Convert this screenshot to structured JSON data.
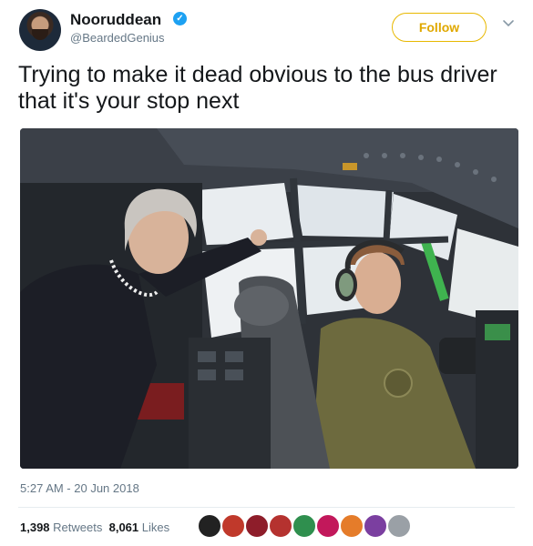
{
  "author": {
    "name": "Nooruddean",
    "handle": "@BeardedGenius",
    "verified_icon": "verified-badge-icon"
  },
  "follow_label": "Follow",
  "tweet_text": "Trying to make it dead obvious to the bus driver that it's your stop next",
  "timestamp": "5:27 AM - 20 Jun 2018",
  "stats": {
    "retweets_count": "1,398",
    "retweets_label": "Retweets",
    "likes_count": "8,061",
    "likes_label": "Likes"
  },
  "colors": {
    "follow_accent": "#e0a800",
    "verified": "#1da1f2",
    "muted": "#657786"
  },
  "liker_avatars": [
    "liker-1",
    "liker-2",
    "liker-3",
    "liker-4",
    "liker-5",
    "liker-6",
    "liker-7",
    "liker-8",
    "liker-9"
  ]
}
